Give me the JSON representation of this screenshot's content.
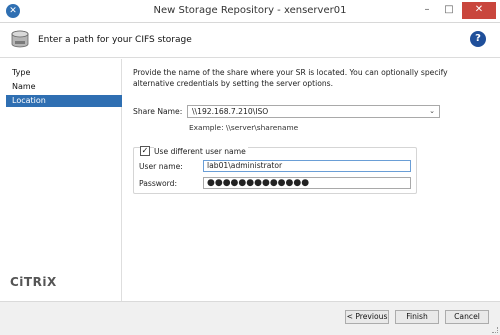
{
  "window": {
    "title": "New Storage Repository - xenserver01",
    "minimize_glyph": "–",
    "maximize_glyph": "□",
    "close_glyph": "✕"
  },
  "header": {
    "text": "Enter a path for your CIFS storage",
    "help_glyph": "?"
  },
  "sidebar": {
    "items": [
      {
        "label": "Type",
        "active": false
      },
      {
        "label": "Name",
        "active": false
      },
      {
        "label": "Location",
        "active": true
      }
    ],
    "logo_text": "CiTRiX"
  },
  "main": {
    "description": "Provide the name of the share where your SR is located. You can optionally specify alternative credentials by setting the server options.",
    "share_label": "Share Name:",
    "share_value": "\\\\192.168.7.210\\ISO",
    "example_text": "Example: \\\\server\\sharename",
    "use_different_label": "Use different user name",
    "use_different_checked": true,
    "username_label": "User name:",
    "username_value": "lab01\\administrator",
    "password_label": "Password:",
    "password_value": "●●●●●●●●●●●●●"
  },
  "footer": {
    "previous_label": "< Previous",
    "finish_label": "Finish",
    "cancel_label": "Cancel"
  }
}
